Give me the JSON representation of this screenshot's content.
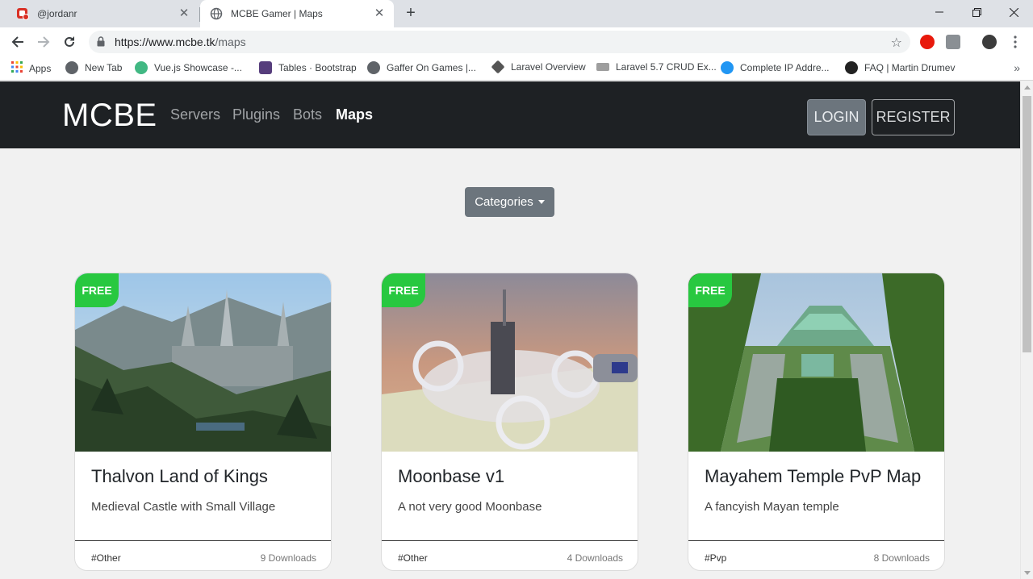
{
  "browser": {
    "tabs": [
      {
        "title": "@jordanr",
        "active": false
      },
      {
        "title": "MCBE Gamer | Maps",
        "active": true
      }
    ],
    "url_host": "https://www.mcbe.tk",
    "url_path": "/maps",
    "bookmarks": [
      {
        "label": "Apps",
        "color": "#ea4335"
      },
      {
        "label": "New Tab",
        "color": "#5f6368"
      },
      {
        "label": "Vue.js Showcase -...",
        "color": "#41b883"
      },
      {
        "label": "Tables · Bootstrap",
        "color": "#563d7c"
      },
      {
        "label": "Gaffer On Games |...",
        "color": "#5f6368"
      },
      {
        "label": "Laravel Overview",
        "color": "#555555"
      },
      {
        "label": "Laravel 5.7 CRUD Ex...",
        "color": "#9e9e9e"
      },
      {
        "label": "Complete IP Addre...",
        "color": "#2196f3"
      },
      {
        "label": "FAQ | Martin Drumev",
        "color": "#222222"
      }
    ]
  },
  "site": {
    "brand": "MCBE",
    "nav": [
      {
        "label": "Servers",
        "active": false
      },
      {
        "label": "Plugins",
        "active": false
      },
      {
        "label": "Bots",
        "active": false
      },
      {
        "label": "Maps",
        "active": true
      }
    ],
    "login_label": "LOGIN",
    "register_label": "REGISTER",
    "categories_label": "Categories"
  },
  "maps": [
    {
      "badge": "FREE",
      "title": "Thalvon Land of Kings",
      "description": "Medieval Castle with Small Village",
      "tag": "#Other",
      "downloads": "9 Downloads"
    },
    {
      "badge": "FREE",
      "title": "Moonbase v1",
      "description": "A not very good Moonbase",
      "tag": "#Other",
      "downloads": "4 Downloads"
    },
    {
      "badge": "FREE",
      "title": "Mayahem Temple PvP Map",
      "description": "A fancyish Mayan temple",
      "tag": "#Pvp",
      "downloads": "8 Downloads"
    }
  ],
  "colors": {
    "navbar_bg": "#1e2124",
    "badge_green": "#28c840",
    "secondary_btn": "#6c757d"
  }
}
